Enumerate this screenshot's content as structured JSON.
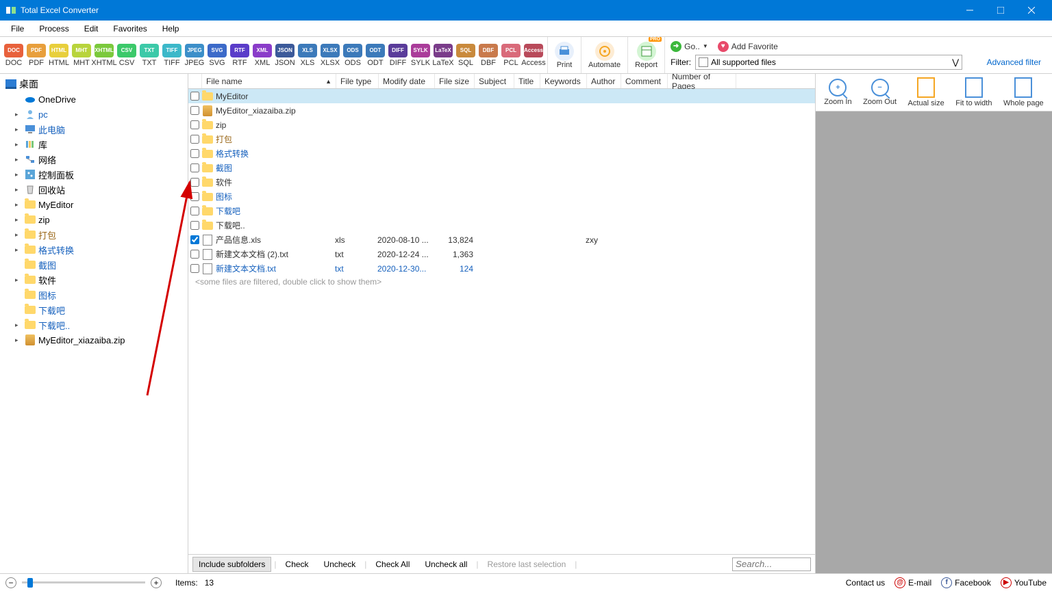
{
  "app": {
    "title": "Total Excel Converter"
  },
  "menu": [
    "File",
    "Process",
    "Edit",
    "Favorites",
    "Help"
  ],
  "formats": [
    {
      "lbl": "DOC",
      "c": "#e8613c"
    },
    {
      "lbl": "PDF",
      "c": "#e89f3c"
    },
    {
      "lbl": "HTML",
      "c": "#e8cf3c"
    },
    {
      "lbl": "MHT",
      "c": "#b8d43c"
    },
    {
      "lbl": "XHTML",
      "c": "#7bc93c"
    },
    {
      "lbl": "CSV",
      "c": "#3cc96a"
    },
    {
      "lbl": "TXT",
      "c": "#3cc9a8"
    },
    {
      "lbl": "TIFF",
      "c": "#3cb8c9"
    },
    {
      "lbl": "JPEG",
      "c": "#3c8fc9"
    },
    {
      "lbl": "SVG",
      "c": "#3c6ac9"
    },
    {
      "lbl": "RTF",
      "c": "#5a3cc9"
    },
    {
      "lbl": "XML",
      "c": "#8a3cc9"
    },
    {
      "lbl": "JSON",
      "c": "#3c5a9a"
    },
    {
      "lbl": "XLS",
      "c": "#3c7aba"
    },
    {
      "lbl": "XLSX",
      "c": "#3c7aba"
    },
    {
      "lbl": "ODS",
      "c": "#3c7aba"
    },
    {
      "lbl": "ODT",
      "c": "#3c7aba"
    },
    {
      "lbl": "DIFF",
      "c": "#5a3c9a"
    },
    {
      "lbl": "SYLK",
      "c": "#aa3c9a"
    },
    {
      "lbl": "LaTeX",
      "c": "#7a3c8a"
    },
    {
      "lbl": "SQL",
      "c": "#c98a3c"
    },
    {
      "lbl": "DBF",
      "c": "#c97a4c"
    },
    {
      "lbl": "PCL",
      "c": "#d96a7a"
    },
    {
      "lbl": "Access",
      "c": "#b84a5a"
    }
  ],
  "bigbtns": {
    "print": "Print",
    "automate": "Automate",
    "report": "Report"
  },
  "links": {
    "go": "Go.. ",
    "fav": "Add Favorite",
    "filter_lbl": "Filter:",
    "filter_val": "All supported files",
    "adv": "Advanced filter"
  },
  "tree": {
    "root": "桌面",
    "items": [
      {
        "exp": "",
        "ico": "cloud",
        "lbl": "OneDrive",
        "cls": ""
      },
      {
        "exp": "▸",
        "ico": "user",
        "lbl": "pc",
        "cls": "blue-link"
      },
      {
        "exp": "▸",
        "ico": "pc",
        "lbl": "此电脑",
        "cls": "blue-link"
      },
      {
        "exp": "▸",
        "ico": "lib",
        "lbl": "库",
        "cls": ""
      },
      {
        "exp": "▸",
        "ico": "net",
        "lbl": "网络",
        "cls": ""
      },
      {
        "exp": "▸",
        "ico": "ctrl",
        "lbl": "控制面板",
        "cls": ""
      },
      {
        "exp": "▸",
        "ico": "bin",
        "lbl": "回收站",
        "cls": ""
      },
      {
        "exp": "▸",
        "ico": "folder",
        "lbl": "MyEditor",
        "cls": ""
      },
      {
        "exp": "▸",
        "ico": "folder",
        "lbl": "zip",
        "cls": ""
      },
      {
        "exp": "▸",
        "ico": "folder",
        "lbl": "打包",
        "cls": "brown-link"
      },
      {
        "exp": "▸",
        "ico": "folder",
        "lbl": "格式转换",
        "cls": "blue-link"
      },
      {
        "exp": "",
        "ico": "folder",
        "lbl": "截图",
        "cls": "blue-link"
      },
      {
        "exp": "▸",
        "ico": "folder",
        "lbl": "软件",
        "cls": ""
      },
      {
        "exp": "",
        "ico": "folder",
        "lbl": "图标",
        "cls": "blue-link"
      },
      {
        "exp": "",
        "ico": "folder",
        "lbl": "下载吧",
        "cls": "blue-link"
      },
      {
        "exp": "▸",
        "ico": "folder",
        "lbl": "下载吧..",
        "cls": "blue-link"
      },
      {
        "exp": "▸",
        "ico": "zip",
        "lbl": "MyEditor_xiazaiba.zip",
        "cls": ""
      }
    ]
  },
  "cols": [
    "File name",
    "File type",
    "Modify date",
    "File size",
    "Subject",
    "Title",
    "Keywords",
    "Author",
    "Comment",
    "Number of Pages"
  ],
  "rows": [
    {
      "chk": false,
      "sel": true,
      "ico": "folder",
      "name": "MyEditor",
      "cls": "",
      "type": "",
      "date": "",
      "size": "",
      "author": ""
    },
    {
      "chk": false,
      "sel": false,
      "ico": "zip",
      "name": "MyEditor_xiazaiba.zip",
      "cls": "",
      "type": "",
      "date": "",
      "size": "",
      "author": ""
    },
    {
      "chk": false,
      "sel": false,
      "ico": "folder",
      "name": "zip",
      "cls": "",
      "type": "",
      "date": "",
      "size": "",
      "author": ""
    },
    {
      "chk": false,
      "sel": false,
      "ico": "folder",
      "name": "打包",
      "cls": "brown-link",
      "type": "",
      "date": "",
      "size": "",
      "author": ""
    },
    {
      "chk": false,
      "sel": false,
      "ico": "folder",
      "name": "格式转换",
      "cls": "blue-link",
      "type": "",
      "date": "",
      "size": "",
      "author": ""
    },
    {
      "chk": false,
      "sel": false,
      "ico": "folder",
      "name": "截图",
      "cls": "blue-link",
      "type": "",
      "date": "",
      "size": "",
      "author": ""
    },
    {
      "chk": false,
      "sel": false,
      "ico": "folder",
      "name": "软件",
      "cls": "",
      "type": "",
      "date": "",
      "size": "",
      "author": ""
    },
    {
      "chk": false,
      "sel": false,
      "ico": "folder",
      "name": "图标",
      "cls": "blue-link",
      "type": "",
      "date": "",
      "size": "",
      "author": ""
    },
    {
      "chk": false,
      "sel": false,
      "ico": "folder",
      "name": "下载吧",
      "cls": "blue-link",
      "type": "",
      "date": "",
      "size": "",
      "author": ""
    },
    {
      "chk": false,
      "sel": false,
      "ico": "folder",
      "name": "下载吧..",
      "cls": "",
      "type": "",
      "date": "",
      "size": "",
      "author": ""
    },
    {
      "chk": true,
      "sel": false,
      "ico": "txt",
      "name": "产品信息.xls",
      "cls": "",
      "type": "xls",
      "date": "2020-08-10 ...",
      "size": "13,824",
      "author": "zxy"
    },
    {
      "chk": false,
      "sel": false,
      "ico": "txt",
      "name": "新建文本文档 (2).txt",
      "cls": "",
      "type": "txt",
      "date": "2020-12-24 ...",
      "size": "1,363",
      "author": ""
    },
    {
      "chk": false,
      "sel": false,
      "ico": "txt",
      "name": "新建文本文档.txt",
      "cls": "blue-link",
      "type": "txt",
      "date": "2020-12-30...",
      "size": "124",
      "author": ""
    }
  ],
  "filtered_note": "<some files are filtered, double click to show them>",
  "footer": {
    "inc": "Include subfolders",
    "check": "Check",
    "uncheck": "Uncheck",
    "checkall": "Check All",
    "uncheckall": "Uncheck all",
    "restore": "Restore last selection",
    "search": "Search..."
  },
  "zoom": [
    "Zoom In",
    "Zoom Out",
    "Actual size",
    "Fit to width",
    "Whole page"
  ],
  "status": {
    "items_lbl": "Items:",
    "items_n": "13",
    "contact": "Contact us",
    "email": "E-mail",
    "fb": "Facebook",
    "yt": "YouTube"
  }
}
